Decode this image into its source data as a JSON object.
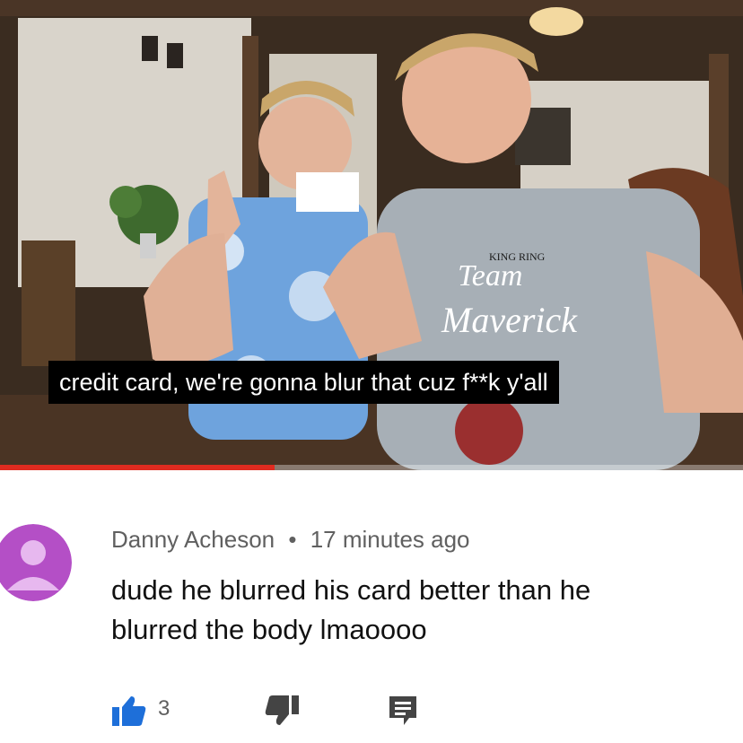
{
  "video": {
    "subtitle": "credit card, we're gonna blur that cuz f**k y'all",
    "progress_fraction": 0.37,
    "shirt_print": [
      "KING RING",
      "Team",
      "Maverick"
    ]
  },
  "comment": {
    "author": "Danny Acheson",
    "separator": "•",
    "time": "17 minutes ago",
    "text_line1": "dude he blurred his card better than he",
    "text_line2": "blurred the body lmaoooo",
    "like_count": "3",
    "icons": [
      "avatar-icon",
      "thumbs-up-icon",
      "thumbs-down-icon",
      "reply-icon"
    ]
  },
  "colors": {
    "progress": "#e02b20",
    "like_icon": "#1e6fd9",
    "avatar_bg": "#b44fc6",
    "avatar_fg": "#e7b8ef",
    "meta_text": "#606060"
  }
}
